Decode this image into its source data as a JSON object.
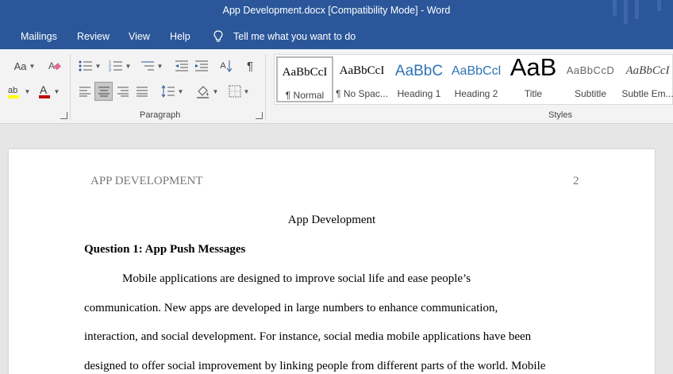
{
  "window": {
    "title": "App Development.docx [Compatibility Mode]  -  Word"
  },
  "menu": {
    "tabs": [
      "Mailings",
      "Review",
      "View",
      "Help"
    ],
    "tell_me": "Tell me what you want to do"
  },
  "ribbon": {
    "font_case_label": "Aa",
    "sort_label": "A",
    "paragraph_group_label": "Paragraph",
    "styles_group_label": "Styles",
    "styles": [
      {
        "sample": "AaBbCcI",
        "name": "¶ Normal"
      },
      {
        "sample": "AaBbCcI",
        "name": "¶ No Spac..."
      },
      {
        "sample": "AaBbC",
        "name": "Heading 1"
      },
      {
        "sample": "AaBbCcl",
        "name": "Heading 2"
      },
      {
        "sample": "AaB",
        "name": "Title"
      },
      {
        "sample": "AaBbCcD",
        "name": "Subtitle"
      },
      {
        "sample": "AaBbCcI",
        "name": "Subtle Em..."
      }
    ],
    "accent_color": "#2b579a",
    "highlight_color": "#ffff00",
    "font_color": "#c00000"
  },
  "document": {
    "header_left": "APP DEVELOPMENT",
    "page_number": "2",
    "title": "App Development",
    "heading": "Question 1: App Push Messages",
    "lines": [
      "Mobile applications are designed to improve social life and ease people’s",
      "communication. New apps are developed in large numbers to enhance communication,",
      "interaction, and social development. For instance, social media mobile applications have been",
      "designed to offer social improvement by linking people from different parts of the world. Mobile"
    ]
  }
}
